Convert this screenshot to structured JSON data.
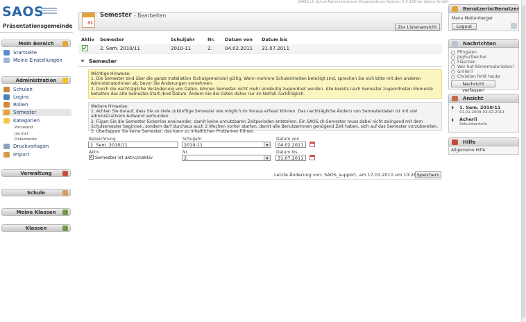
{
  "system_info": "SAOS.ch Schul-Administrations-Organisations-System 0.5.100 by digivo GmbH",
  "logo": {
    "text": "SAOS",
    "school": "Präsentationsgemeinde"
  },
  "sidebar": {
    "mein_bereich": {
      "title": "Mein Bereich",
      "items": [
        {
          "label": "Startseite"
        },
        {
          "label": "Meine Einstellungen"
        }
      ]
    },
    "administration": {
      "title": "Administration",
      "items": [
        {
          "label": "Schulen"
        },
        {
          "label": "Logins"
        },
        {
          "label": "Rollen"
        },
        {
          "label": "Semester"
        },
        {
          "label": "Kategorien"
        }
      ],
      "sub_items": [
        "Pinnwand",
        "Journal",
        "Dokumente"
      ],
      "more_items": [
        "Druckvorlagen",
        "Import"
      ]
    },
    "collapsed": [
      {
        "title": "Verwaltung"
      },
      {
        "title": "Schule"
      },
      {
        "title": "Meine Klassen"
      },
      {
        "title": "Klassen"
      }
    ]
  },
  "header": {
    "title": "Semester",
    "subtitle": "- Bearbeiten",
    "calendar_day": "31",
    "back_button": "Zur Listenansicht"
  },
  "table": {
    "columns": [
      "Aktiv",
      "Semester",
      "Schuljahr",
      "Nr.",
      "Datum von",
      "Datum bis"
    ],
    "row": {
      "aktiv": "✔",
      "semester": "2. Sem. 2010/11",
      "schuljahr": "2010-11",
      "nr": "2.",
      "datum_von": "04.02.2011",
      "datum_bis": "31.07.2011"
    }
  },
  "section": {
    "title": "Semester"
  },
  "warning": {
    "title": "Wichtige Hinweise:",
    "line1": "1. Die Semester sind über die ganze Installation (Schulgemeinde) gültig. Wenn mehrere Schuleinheiten beteiligt sind, sprechen Sie sich bitte mit den anderen",
    "line1b": "AdministratorInnen ab, bevor Sie Änderungen vornehmen.",
    "line2": "2. Durch die nachträgliche Veränderung von Daten, können Semester nicht mehr eindeutig zugeordnet werden. Alle bereits nach Semester zugeordneten Elemente",
    "line2b": "behalten das alte Semester-Start-/End-Datum. Ändern Sie die Daten daher nur im Notfall nachträglich."
  },
  "info": {
    "title": "Weitere Hinweise:",
    "line1": "1. Achten Sie darauf, dass Sie so viele zukünftige Semester wie möglich im Voraus erfasst können. Das nachträgliche Ändern von Semesterdaten ist mit viel",
    "line1b": "administrativem Aufwand verbunden.",
    "line2": "2. Fügen Sie die Semester lückenlos aneinander, damit keine unnutzbaren Zeitperioden entstehen. Ein SAOS.ch-Semester muss dabei nicht zwingend mit dem",
    "line2b": "Schulsemester beginnen, sondern darf durchaus auch 2 Wochen vorher starten, damit alle BenutzerInnen genügend Zeit haben, sich auf das Semester vorzubereiten.",
    "line3": "3. Überlappen Sie keine Semester, das kann zu inhaltlichen Problemen führen."
  },
  "form": {
    "bezeichnung": {
      "label": "Bezeichnung",
      "value": "2. Sem. 2010/11"
    },
    "schuljahr": {
      "label": "Schuljahr",
      "value": "2010-11"
    },
    "datum_von": {
      "label": "Datum von",
      "value": "04.02.2011"
    },
    "aktiv": {
      "label": "Aktiv",
      "checkbox_label": "Semester ist aktiv/inaktiv",
      "checked": true
    },
    "nr": {
      "label": "Nr.",
      "value": "2."
    },
    "datum_bis": {
      "label": "Datum bis",
      "value": "31.07.2011"
    },
    "last_change": "Letzte Änderung von: SAOS_support, am 17.03.2010 um 10:28",
    "save_button": "Speichern"
  },
  "right": {
    "user": {
      "title": "Benutzerin/Benutzer",
      "name": "Manu Mattenberger",
      "logout": "Logout"
    },
    "news": {
      "title": "Nachrichten",
      "poll": [
        "Pfingsten",
        "Joghurtbecher",
        "Flaschen",
        "Wer hat Römermaterialien?",
        "Grillen?",
        "Christian fehlt heute"
      ],
      "button": "Nachricht verfassen"
    },
    "view": {
      "title": "Ansicht",
      "items": [
        {
          "title": "1. Sem. 2010/11",
          "sub": "01.01.2009-03.02.2011"
        },
        {
          "title": "Acherli",
          "sub": "Sekundarstufe"
        }
      ]
    },
    "help": {
      "title": "Hilfe",
      "text": "Allgemeine Hilfe"
    }
  },
  "colors": {
    "accent": "#2a66a8",
    "warning_bg": "#fcf5bf",
    "panel": "#cfcfcf"
  }
}
